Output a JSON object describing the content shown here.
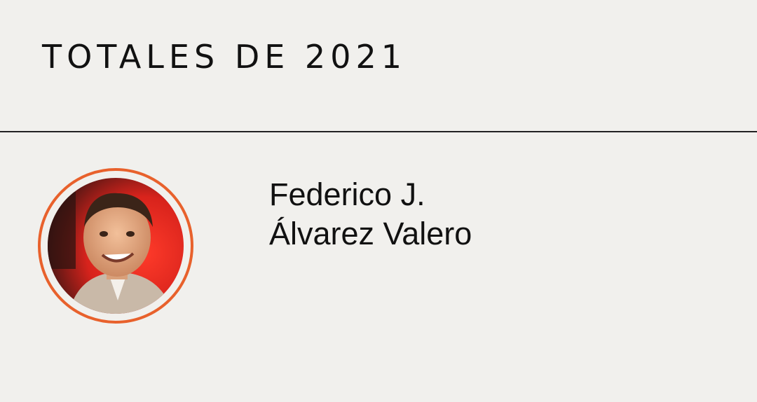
{
  "header": {
    "title": "TOTALES DE 2021"
  },
  "author": {
    "name_line_1": "Federico J.",
    "name_line_2": "Álvarez Valero"
  },
  "colors": {
    "background": "#f1f0ed",
    "accent_ring": "#e8612c",
    "text": "#111111",
    "divider": "#222222"
  },
  "icons": {
    "avatar": "person-photo"
  }
}
